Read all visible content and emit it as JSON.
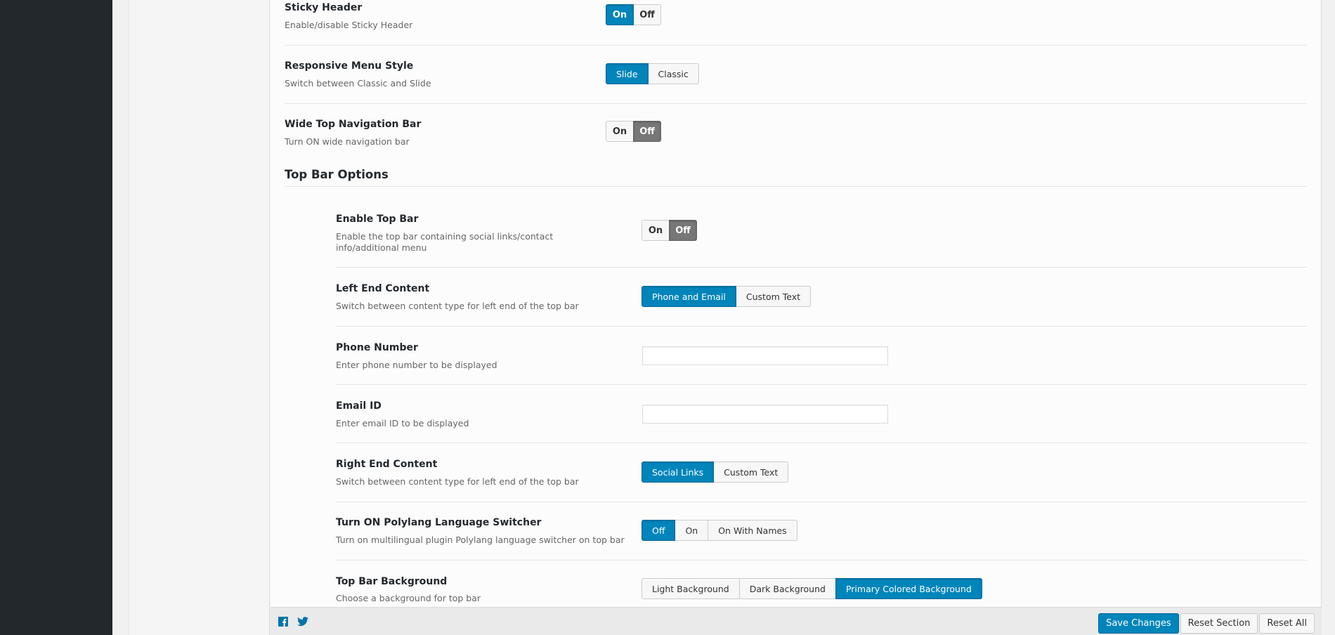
{
  "sticky_header": {
    "title": "Sticky Header",
    "desc": "Enable/disable Sticky Header",
    "on": "On",
    "off": "Off",
    "state": "on"
  },
  "responsive_menu": {
    "title": "Responsive Menu Style",
    "desc": "Switch between Classic and Slide",
    "options": [
      "Slide",
      "Classic"
    ],
    "selected": "Slide"
  },
  "wide_nav": {
    "title": "Wide Top Navigation Bar",
    "desc": "Turn ON wide navigation bar",
    "on": "On",
    "off": "Off",
    "state": "off"
  },
  "top_bar_section": {
    "title": "Top Bar Options"
  },
  "enable_top_bar": {
    "title": "Enable Top Bar",
    "desc": "Enable the top bar containing social links/contact info/additional menu",
    "on": "On",
    "off": "Off",
    "state": "off"
  },
  "left_end": {
    "title": "Left End Content",
    "desc": "Switch between content type for left end of the top bar",
    "options": [
      "Phone and Email",
      "Custom Text"
    ],
    "selected": "Phone and Email"
  },
  "phone_number": {
    "title": "Phone Number",
    "desc": "Enter phone number to be displayed",
    "value": ""
  },
  "email_id": {
    "title": "Email ID",
    "desc": "Enter email ID to be displayed",
    "value": ""
  },
  "right_end": {
    "title": "Right End Content",
    "desc": "Switch between content type for left end of the top bar",
    "options": [
      "Social Links",
      "Custom Text"
    ],
    "selected": "Social Links"
  },
  "polylang": {
    "title": "Turn ON Polylang Language Switcher",
    "desc": "Turn on multilingual plugin Polylang language switcher on top bar",
    "options": [
      "Off",
      "On",
      "On With Names"
    ],
    "selected": "Off"
  },
  "top_bar_bg": {
    "title": "Top Bar Background",
    "desc": "Choose a background for top bar",
    "options": [
      "Light Background",
      "Dark Background",
      "Primary Colored Background"
    ],
    "selected": "Primary Colored Background"
  },
  "footer": {
    "facebook_icon": "facebook-icon",
    "twitter_icon": "twitter-icon",
    "save": "Save Changes",
    "reset_section": "Reset Section",
    "reset_all": "Reset All"
  },
  "colors": {
    "accent": "#0085ba",
    "admin_sidebar": "#23282d",
    "off_active": "#777777"
  }
}
